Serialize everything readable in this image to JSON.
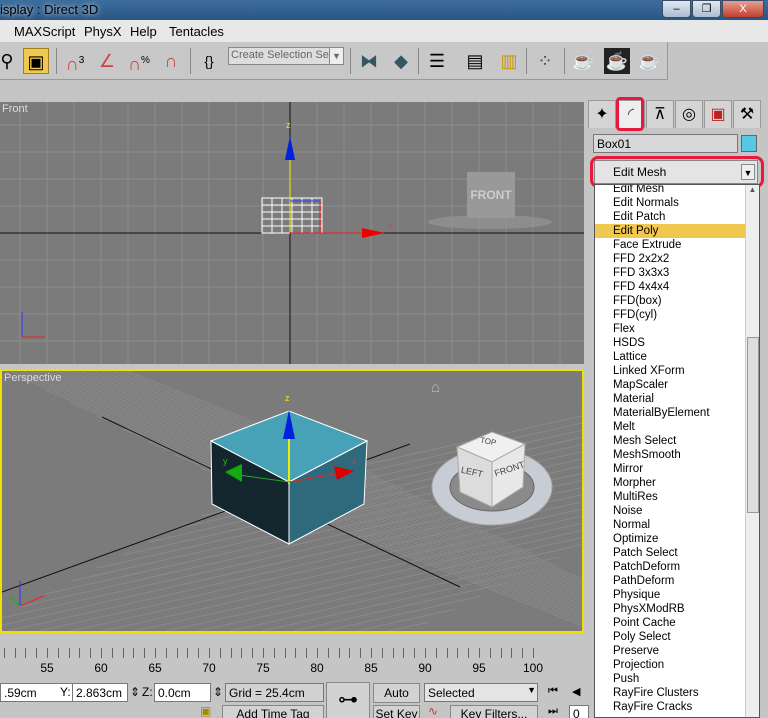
{
  "window": {
    "title": "isplay : Direct 3D",
    "min": "–",
    "restore": "❐",
    "close": "X"
  },
  "menu": [
    "MAXScript",
    "PhysX",
    "Help",
    "Tentacles"
  ],
  "toolbar": {
    "selection_set_placeholder": "Create Selection Set",
    "snap_label": "3",
    "angle_label": "%"
  },
  "viewports": {
    "front": {
      "label": "Front",
      "viewcube": "FRONT"
    },
    "perspective": {
      "label": "Perspective",
      "cube_top": "TOP",
      "cube_left": "LEFT",
      "cube_front": "FRONT"
    }
  },
  "axes": {
    "x": "x",
    "y": "y",
    "z": "z"
  },
  "colors": {
    "object": "#54c8e4",
    "highlight": "#f0c850",
    "active_viewport": "#f0e000",
    "annotation": "#e8193c"
  },
  "panel": {
    "object_name": "Box01",
    "modifier_selected": "Edit Mesh",
    "modifiers": [
      "Edit Mesh",
      "Edit Normals",
      "Edit Patch",
      "Edit Poly",
      "Face Extrude",
      "FFD 2x2x2",
      "FFD 3x3x3",
      "FFD 4x4x4",
      "FFD(box)",
      "FFD(cyl)",
      "Flex",
      "HSDS",
      "Lattice",
      "Linked XForm",
      "MapScaler",
      "Material",
      "MaterialByElement",
      "Melt",
      "Mesh Select",
      "MeshSmooth",
      "Mirror",
      "Morpher",
      "MultiRes",
      "Noise",
      "Normal",
      "Optimize",
      "Patch Select",
      "PatchDeform",
      "PathDeform",
      "Physique",
      "PhysXModRB",
      "Point Cache",
      "Poly Select",
      "Preserve",
      "Projection",
      "Push",
      "RayFire Clusters",
      "RayFire Cracks"
    ],
    "highlighted": "Edit Poly"
  },
  "timeline": {
    "labels": [
      "55",
      "60",
      "65",
      "70",
      "75",
      "80",
      "85",
      "90",
      "95",
      "100"
    ]
  },
  "status": {
    "x_value": ".59cm",
    "y_label": "Y:",
    "y_value": "2.863cm",
    "z_label": "Z:",
    "z_value": "0.0cm",
    "grid": "Grid = 25.4cm",
    "auto_key": "Auto Key",
    "set_key": "Set Key",
    "key_mode": "Selected",
    "key_filters": "Key Filters...",
    "add_time_tag": "Add Time Tag",
    "frame": "0"
  }
}
